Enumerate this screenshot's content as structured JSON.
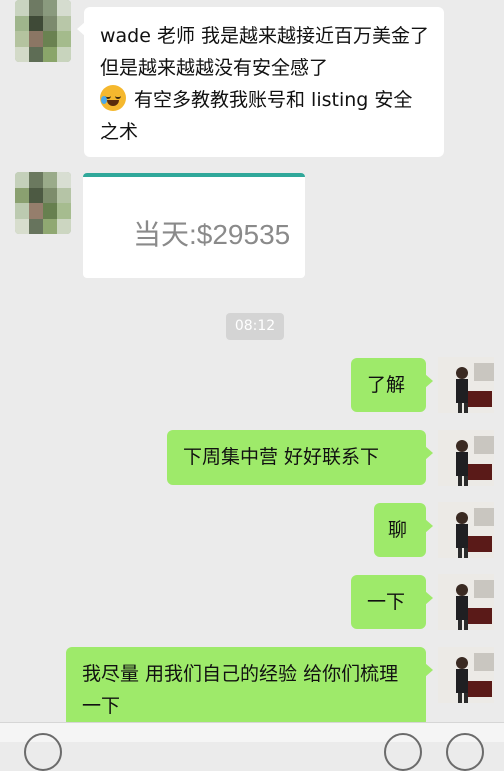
{
  "messages": [
    {
      "text": "wade 老师  我是越来越接近百万美金了  但是越来越越没有安全感了",
      "text2": "有空多教教我账号和 listing 安全之术"
    },
    {
      "image_text": "当天:$29535"
    },
    {
      "timestamp": "08:12"
    },
    {
      "text": "了解"
    },
    {
      "text": "下周集中营 好好联系下"
    },
    {
      "text": "聊"
    },
    {
      "text": "一下"
    },
    {
      "text": "我尽量 用我们自己的经验 给你们梳理一下"
    }
  ],
  "icons": {
    "emoji": "crying-laughing-emoji-icon",
    "avatar_left": "blurred-avatar",
    "avatar_right": "presenter-avatar"
  },
  "colors": {
    "background": "#ebebeb",
    "incoming_bubble": "#ffffff",
    "outgoing_bubble": "#9eea6a",
    "time_badge": "#d4d4d4"
  }
}
